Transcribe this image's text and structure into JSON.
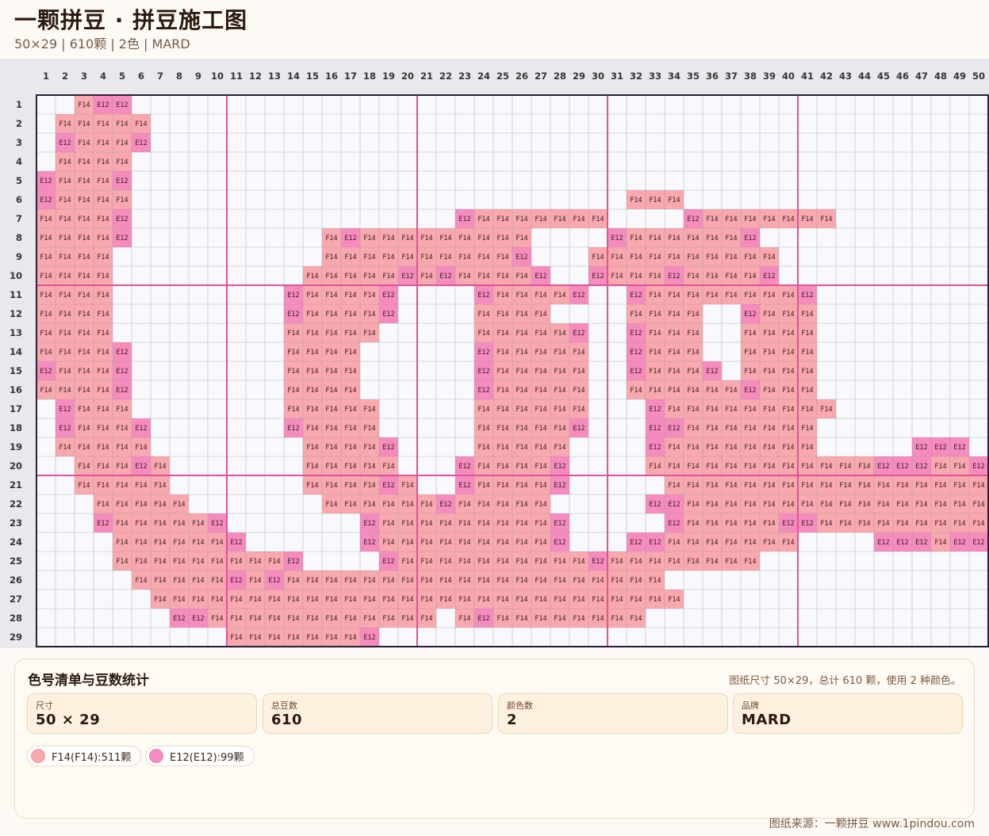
{
  "header": {
    "title": "一颗拼豆 · 拼豆施工图",
    "subtitle": "50×29 | 610颗 | 2色 | MARD"
  },
  "grid": {
    "cols": 50,
    "rows": 29,
    "colors": {
      "F14": "#f9a8ae",
      "E12": "#f68bbd",
      "empty": "#f8f9fc",
      "gridline": "#9aa0aa",
      "major_line": "#e0529a",
      "border": "#2a2036"
    },
    "row_data": [
      "..FEE.............................................",
      ".FFFFF............................................",
      ".EFFFE............................................",
      ".FFFF.............................................",
      "EFFFE.............................................",
      "EFFFF..........................FFF................",
      "FFFFE.................EFFFFFFF....EFFFFFFF............",
      "FFFFE..........FEFFFFFFFFF....EFFFFFFE............",
      "FFFF...........FFFFFFFFFFE...FFFFFFFFFF............",
      "FFFF..........FFFFFEFEFFFFE..EFFFEFFFFE............",
      "FFFF.........EFFFFE....EFFFFE..EFFFFFFFFE............",
      "FFFF.........EFFFFE....FFFF....FFFF..EFFF............",
      "FFFF.........FFFFF.....FFFFFE..EFFF..FFFF............",
      "FFFFE........FFFF......EFFFFF..EFFF..FFFF............",
      "EFFFE........FFFF......EFFFFF..EFFFE.FFFF............",
      "FFFFE........FFFF......EFFFFF..FFFFFFEFFF............",
      ".EFFF........FFFFF.....FFFFFF...EFFFFFFFFF............",
      ".EFFFE.......EFFFF.....FFFFFE...EEFFFFFFF............",
      ".FFFFF........FFFFE....FFFFF....EFFFFFFFF.....EEE.",
      "..FFFEF.......FFFFF...EFFFFE....FFFFFFFFFFFFEEEFFEFFE",
      "..FFFFF.......FFFFEF..EFFFFE.....FFFFFFFFFFFFFFFFFFE",
      "...FFFFF.......FFFFFFEFFFFF.....EEFFFFFFFFFFFFFFFFFFF",
      "...EFFFFFE.......EFFFFFFFFFE.....EFFFFFEEFFFFFFFFFFE.",
      "....FFFFFFE......EFFFFFFFFFE...EEFFFFFFF....EEEFEEEE....",
      "....FFFFFFFFFE....EFFFFFFFFFFEFFFFFFFF...................",
      ".....FFFFFEFEFFFFFFFFFFFFFFFFFFFF.................",
      "......FFFFFFFFFFFFFFFFFFFFFFFFFFFF................",
      ".......EEFFFFFFFFFFFF.FEFFFFFFFF..................",
      "..........FFFFFFFE................................"
    ]
  },
  "legend": {
    "title": "色号清单与豆数统计",
    "summary": "图纸尺寸 50×29，总计 610 颗，使用 2 种颜色。",
    "stats": [
      {
        "label": "尺寸",
        "value": "50 × 29"
      },
      {
        "label": "总豆数",
        "value": "610"
      },
      {
        "label": "颜色数",
        "value": "2"
      },
      {
        "label": "品牌",
        "value": "MARD"
      }
    ],
    "chips": [
      {
        "text": "F14(F14):511颗",
        "color": "#f9a8ae"
      },
      {
        "text": "E12(E12):99颗",
        "color": "#f68bbd"
      }
    ]
  },
  "footer": {
    "source": "图纸来源：一颗拼豆 www.1pindou.com"
  }
}
